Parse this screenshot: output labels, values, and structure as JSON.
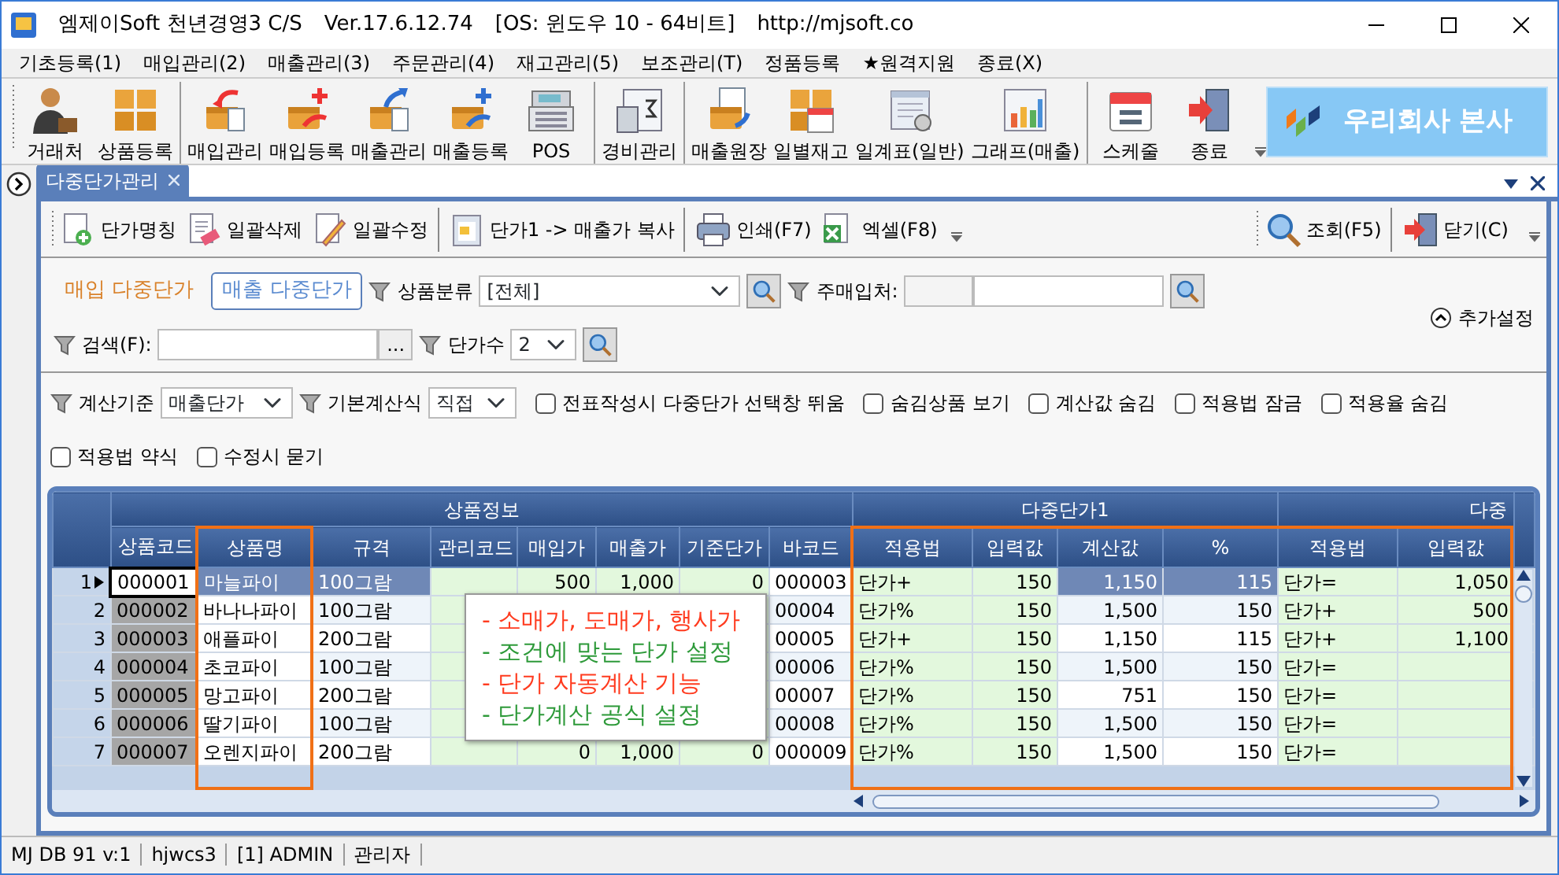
{
  "window": {
    "title_parts": [
      "엠제이Soft 천년경영3 C/S",
      "Ver.17.6.12.74",
      "[OS: 윈도우 10 - 64비트]",
      "http://mjsoft.co"
    ]
  },
  "menu": [
    "기초등록(1)",
    "매입관리(2)",
    "매출관리(3)",
    "주문관리(4)",
    "재고관리(5)",
    "보조관리(T)",
    "정품등록",
    "★원격지원",
    "종료(X)"
  ],
  "toolbar": [
    [
      "거래처",
      "상품등록"
    ],
    [
      "매입관리",
      "매입등록",
      "매출관리",
      "매출등록",
      "POS"
    ],
    [
      "경비관리"
    ],
    [
      "매출원장",
      "일별재고",
      "일계표(일반)",
      "그래프(매출)"
    ],
    [
      "스케줄",
      "종료"
    ]
  ],
  "company_banner": {
    "label": "우리회사 본사"
  },
  "document_tabs": [
    {
      "label": "다중단가관리",
      "selected": true
    }
  ],
  "command_bar": {
    "left": [
      [
        "단가명칭",
        "일괄삭제",
        "일괄수정"
      ],
      [
        "단가1 -> 매출가 복사"
      ],
      [
        "인쇄(F7)",
        "엑셀(F8)"
      ]
    ],
    "right": [
      [
        "조회(F5)"
      ],
      [
        "닫기(C)"
      ]
    ]
  },
  "filters": {
    "price_modes": [
      {
        "label": "매입 다중단가",
        "selected": false
      },
      {
        "label": "매출 다중단가",
        "selected": true
      }
    ],
    "category": {
      "label": "상품분류",
      "value": "[전체]"
    },
    "supplier": {
      "label": "주매입처:"
    },
    "search": {
      "label": "검색(F):",
      "button": "..."
    },
    "price_count": {
      "label": "단가수",
      "value": "2"
    },
    "more_settings": {
      "label": "추가설정",
      "expanded": true
    }
  },
  "options": {
    "calc_basis": {
      "label": "계산기준",
      "value": "매출단가"
    },
    "base_formula": {
      "label": "기본계산식",
      "value": "직접"
    },
    "checkboxes": [
      {
        "label": "전표작성시 다중단가 선택창 뛰움",
        "checked": false
      },
      {
        "label": "숨김상품 보기",
        "checked": false
      },
      {
        "label": "계산값 숨김",
        "checked": false
      },
      {
        "label": "적용법 잠금",
        "checked": false
      },
      {
        "label": "적용율 숨김",
        "checked": false
      },
      {
        "label": "적용법 약식",
        "checked": false
      },
      {
        "label": "수정시 묻기",
        "checked": false
      }
    ]
  },
  "grid": {
    "column_groups": [
      {
        "label": "상품정보",
        "columns": [
          "상품코드",
          "상품명",
          "규격",
          "관리코드",
          "매입가",
          "매출가",
          "기준단가",
          "바코드"
        ]
      },
      {
        "label": "다중단가1",
        "columns": [
          "적용법",
          "입력값",
          "계산값",
          "%"
        ]
      },
      {
        "label": "다중",
        "columns": [
          "적용법",
          "입력값"
        ]
      }
    ],
    "rows": [
      {
        "number": "1",
        "selected": true,
        "cells": [
          "000001",
          "마늘파이",
          "100그람",
          null,
          "500",
          "1,000",
          "0",
          "000003",
          "단가+",
          "150",
          "1,150",
          "115",
          "단가=",
          "1,050"
        ]
      },
      {
        "number": "2",
        "selected": false,
        "cells": [
          "000002",
          "바나나파이",
          "100그람",
          null,
          null,
          null,
          null,
          "00004",
          "단가%",
          "150",
          "1,500",
          "150",
          "단가+",
          "500"
        ]
      },
      {
        "number": "3",
        "selected": false,
        "cells": [
          "000003",
          "애플파이",
          "200그람",
          null,
          null,
          null,
          null,
          "00005",
          "단가+",
          "150",
          "1,150",
          "115",
          "단가+",
          "1,100"
        ]
      },
      {
        "number": "4",
        "selected": false,
        "cells": [
          "000004",
          "초코파이",
          "100그람",
          null,
          null,
          null,
          null,
          "00006",
          "단가%",
          "150",
          "1,500",
          "150",
          "단가=",
          null
        ]
      },
      {
        "number": "5",
        "selected": false,
        "cells": [
          "000005",
          "망고파이",
          "200그람",
          null,
          null,
          null,
          null,
          "00007",
          "단가%",
          "150",
          "751",
          "150",
          "단가=",
          null
        ]
      },
      {
        "number": "6",
        "selected": false,
        "cells": [
          "000006",
          "딸기파이",
          "100그람",
          null,
          null,
          null,
          null,
          "00008",
          "단가%",
          "150",
          "1,500",
          "150",
          "단가=",
          null
        ]
      },
      {
        "number": "7",
        "selected": false,
        "cells": [
          "000007",
          "오렌지파이",
          "200그람",
          null,
          "0",
          "1,000",
          "0",
          "000009",
          "단가%",
          "150",
          "1,500",
          "150",
          "단가=",
          null
        ]
      }
    ]
  },
  "callout": {
    "lines": [
      {
        "text": "- 소매가, 도매가, 행사가",
        "color": "#ff3b1f"
      },
      {
        "text": "- 조건에 맞는 단가 설정",
        "color": "#2e9a3a"
      },
      {
        "text": "- 단가 자동계산 기능",
        "color": "#ff3b1f"
      },
      {
        "text": "- 단가계산 공식 설정",
        "color": "#2e9a3a"
      }
    ]
  },
  "status_bar": [
    "MJ DB 91 v:1",
    "hjwcs3",
    "[1] ADMIN",
    "관리자"
  ]
}
